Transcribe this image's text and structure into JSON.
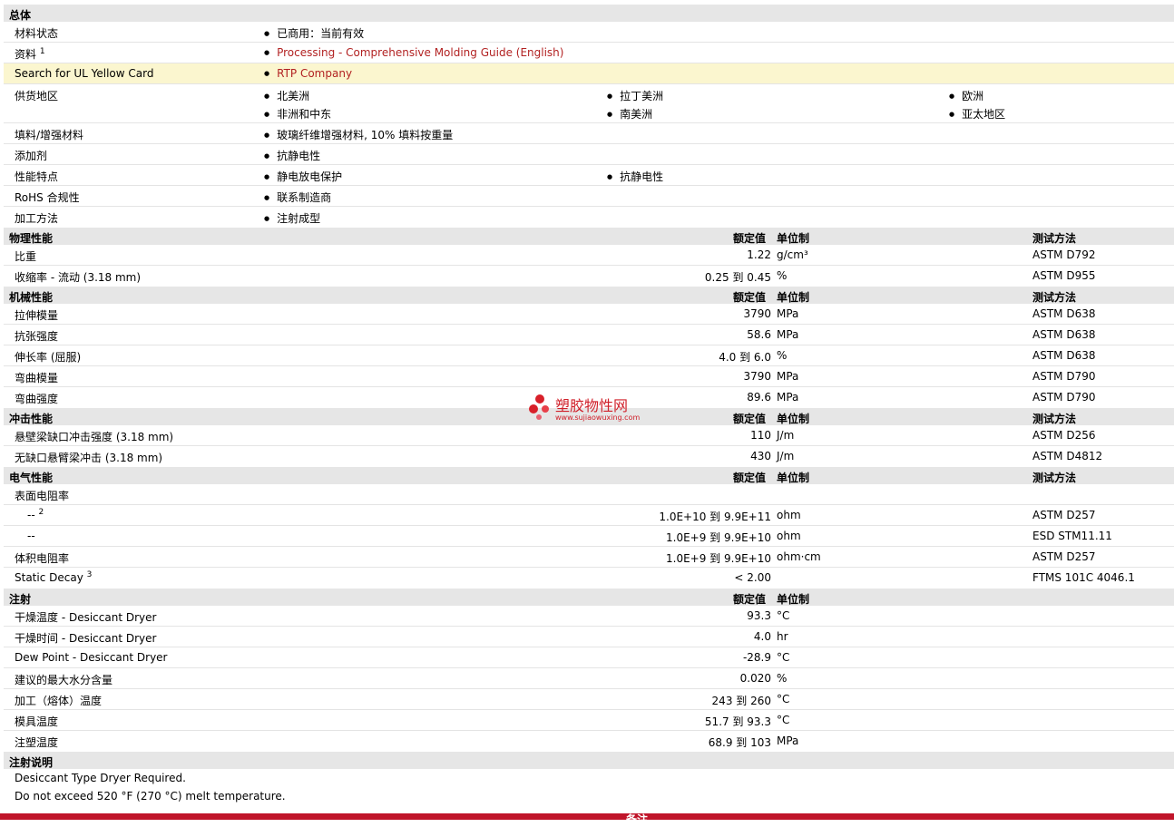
{
  "general": {
    "title": "总体",
    "status_label": "材料状态",
    "status_value": "已商用：当前有效",
    "docs_label": "资料",
    "docs_sup": "1",
    "docs_link": "Processing - Comprehensive Molding Guide (English)",
    "ul_label": "Search for UL Yellow Card",
    "ul_link": "RTP Company",
    "supply_label": "供货地区",
    "supply": [
      "北美洲",
      "拉丁美洲",
      "欧洲",
      "非洲和中东",
      "南美洲",
      "亚太地区"
    ],
    "filler_label": "填料/增强材料",
    "filler_value": "玻璃纤维增强材料, 10% 填料按重量",
    "additive_label": "添加剂",
    "additive_value": "抗静电性",
    "features_label": "性能特点",
    "features": [
      "静电放电保护",
      "抗静电性"
    ],
    "rohs_label": "RoHS 合规性",
    "rohs_value": "联系制造商",
    "process_label": "加工方法",
    "process_value": "注射成型"
  },
  "headers": {
    "nominal": "额定值",
    "unit": "单位制",
    "test": "测试方法"
  },
  "physical": {
    "title": "物理性能",
    "rows": [
      {
        "name": "比重",
        "value": "1.22",
        "unit": "g/cm³",
        "test": "ASTM D792"
      },
      {
        "name": "收缩率  - 流动  (3.18 mm)",
        "value": "0.25 到  0.45",
        "unit": "%",
        "test": "ASTM D955"
      }
    ]
  },
  "mechanical": {
    "title": "机械性能",
    "rows": [
      {
        "name": "拉伸模量",
        "value": "3790",
        "unit": "MPa",
        "test": "ASTM D638"
      },
      {
        "name": "抗张强度",
        "value": "58.6",
        "unit": "MPa",
        "test": "ASTM D638"
      },
      {
        "name": "伸长率  (屈服)",
        "value": "4.0 到  6.0",
        "unit": "%",
        "test": "ASTM D638"
      },
      {
        "name": "弯曲模量",
        "value": "3790",
        "unit": "MPa",
        "test": "ASTM D790"
      },
      {
        "name": "弯曲强度",
        "value": "89.6",
        "unit": "MPa",
        "test": "ASTM D790"
      }
    ]
  },
  "impact": {
    "title": "冲击性能",
    "rows": [
      {
        "name": "悬壁梁缺口冲击强度  (3.18 mm)",
        "value": "110",
        "unit": "J/m",
        "test": "ASTM D256"
      },
      {
        "name": "无缺口悬臂梁冲击  (3.18 mm)",
        "value": "430",
        "unit": "J/m",
        "test": "ASTM D4812"
      }
    ]
  },
  "electrical": {
    "title": "电气性能",
    "surface_label": "表面电阻率",
    "sub1_label": "--",
    "sub1_sup": "2",
    "sub1_value": "1.0E+10 到  9.9E+11",
    "sub1_unit": "ohm",
    "sub1_test": "ASTM D257",
    "sub2_label": "--",
    "sub2_value": "1.0E+9 到  9.9E+10",
    "sub2_unit": "ohm",
    "sub2_test": "ESD STM11.11",
    "volume_label": "体积电阻率",
    "volume_value": "1.0E+9 到  9.9E+10",
    "volume_unit": "ohm·cm",
    "volume_test": "ASTM D257",
    "decay_label": "Static Decay",
    "decay_sup": "3",
    "decay_value": "< 2.00",
    "decay_test": "FTMS 101C 4046.1"
  },
  "injection": {
    "title": "注射",
    "rows": [
      {
        "name": "干燥温度  - Desiccant Dryer",
        "value": "93.3",
        "unit": "°C"
      },
      {
        "name": "干燥时间  - Desiccant Dryer",
        "value": "4.0",
        "unit": "hr"
      },
      {
        "name": "Dew Point - Desiccant Dryer",
        "value": "-28.9",
        "unit": "°C"
      },
      {
        "name": "建议的最大水分含量",
        "value": "0.020",
        "unit": "%"
      },
      {
        "name": "加工（熔体）温度",
        "value": "243 到  260",
        "unit": "°C"
      },
      {
        "name": "模具温度",
        "value": "51.7 到  93.3",
        "unit": "°C"
      },
      {
        "name": "注塑温度",
        "value": "68.9 到  103",
        "unit": "MPa"
      }
    ]
  },
  "injection_notes": {
    "title": "注射说明",
    "lines": [
      "Desiccant Type Dryer Required.",
      "Do not exceed 520 °F (270 °C) melt temperature."
    ]
  },
  "footer": {
    "label": "备注"
  },
  "watermark": {
    "name": "塑胶物性网",
    "url": "www.sujiaowuxing.com"
  }
}
